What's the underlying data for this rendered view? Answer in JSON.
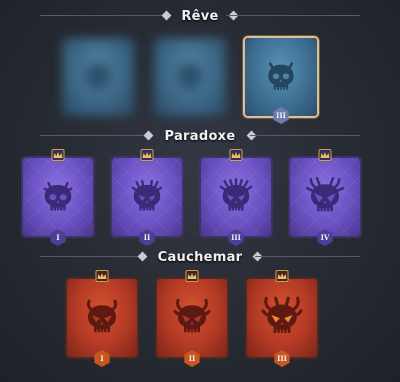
{
  "sections": {
    "reve": {
      "title": "Rêve",
      "cards": [
        {
          "tier": "",
          "state": "locked-blurred"
        },
        {
          "tier": "",
          "state": "locked-blurred"
        },
        {
          "tier": "III",
          "state": "selected"
        }
      ]
    },
    "paradoxe": {
      "title": "Paradoxe",
      "cards": [
        {
          "tier": "I"
        },
        {
          "tier": "II"
        },
        {
          "tier": "III"
        },
        {
          "tier": "IV"
        }
      ]
    },
    "cauchemar": {
      "title": "Cauchemar",
      "cards": [
        {
          "tier": "I"
        },
        {
          "tier": "II"
        },
        {
          "tier": "III"
        }
      ]
    }
  },
  "colors": {
    "reve": "#4d82a6",
    "paradoxe": "#6a51c2",
    "cauchemar": "#b23a24",
    "selected_border": "#d8c29e",
    "crown": "#c8a24a"
  },
  "icons": {
    "card_emblem": "skull-icon",
    "badge": "crown-icon"
  }
}
